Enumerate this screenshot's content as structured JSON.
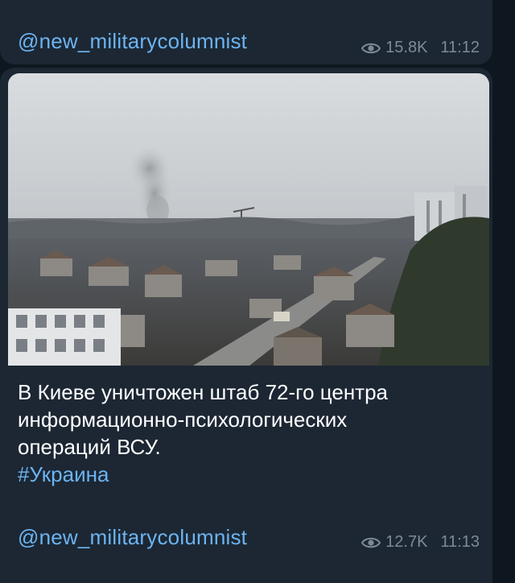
{
  "first_message": {
    "signature": "@new_military columnist",
    "views": "15.8K",
    "time": "11:12"
  },
  "second_message": {
    "photo_icon": "photo-of-city-with-smoke",
    "text_lines": [
      "В Киеве уничтожен штаб 72-го центра",
      "информационно-психологических",
      "операций ВСУ."
    ],
    "hashtag": "#Украина",
    "signature": "@new_militarycolumnist",
    "views": "12.7K",
    "time": "11:13"
  },
  "colors": {
    "background": "#0e1620",
    "bubble": "#1c2733",
    "link": "#6cb4f2",
    "meta": "#7d8b99",
    "text": "#ffffff"
  }
}
